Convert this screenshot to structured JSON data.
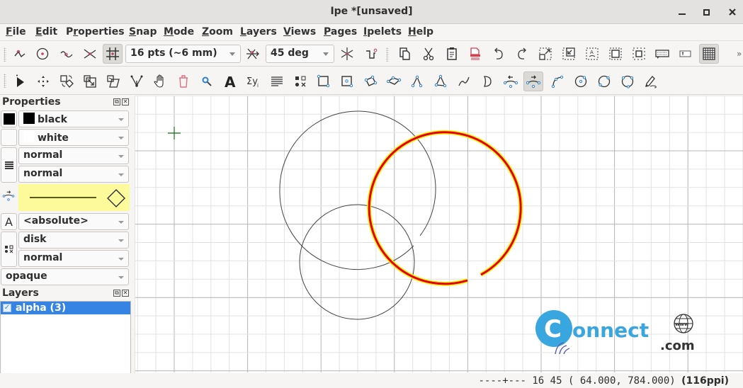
{
  "window": {
    "title": "Ipe *[unsaved]",
    "minimize_icon": "minimize-icon",
    "maximize_icon": "maximize-icon",
    "close_icon": "close-icon"
  },
  "menu": [
    {
      "label": "File",
      "mnemonic": "F",
      "rest": "ile"
    },
    {
      "label": "Edit",
      "mnemonic": "E",
      "rest": "dit"
    },
    {
      "label": "Properties",
      "pre": "P",
      "mnemonic": "r",
      "rest": "operties"
    },
    {
      "label": "Snap",
      "mnemonic": "S",
      "rest": "nap"
    },
    {
      "label": "Mode",
      "mnemonic": "M",
      "rest": "ode"
    },
    {
      "label": "Zoom",
      "mnemonic": "Z",
      "rest": "oom"
    },
    {
      "label": "Layers",
      "mnemonic": "L",
      "rest": "ayers"
    },
    {
      "label": "Views",
      "mnemonic": "V",
      "rest": "iews"
    },
    {
      "label": "Pages",
      "mnemonic": "P",
      "rest": "ages"
    },
    {
      "label": "Ipelets",
      "mnemonic": "I",
      "rest": "pelets"
    },
    {
      "label": "Help",
      "mnemonic": "H",
      "rest": "elp"
    }
  ],
  "snap_toolbar": {
    "buttons": [
      "snap-vertex-icon",
      "snap-center-icon",
      "snap-boundary-icon",
      "snap-intersection-icon",
      "snap-grid-icon"
    ],
    "grid_size": "16 pts (~6 mm)",
    "angle_snap_icon": "snap-angle-icon",
    "angle": "45 deg",
    "after_angle": [
      "snap-autoangle-icon",
      "snap-custom-icon"
    ]
  },
  "edit_toolbar": {
    "buttons": [
      "copy-icon",
      "cut-icon",
      "paste-icon",
      "delete-icon",
      "undo-icon",
      "redo-icon",
      "fit-page-icon",
      "fit-objects-icon",
      "fit-selection-icon",
      "zoom-in-icon",
      "zoom-out-icon",
      "keyboard-icon",
      "text-insert-icon",
      "grid-visible-icon"
    ],
    "overflow": "»"
  },
  "mode_toolbar": {
    "buttons": [
      "select-icon",
      "translate-icon",
      "rotate-icon",
      "stretch-icon",
      "shear-icon",
      "graph-icon",
      "pan-icon",
      "shred-icon",
      "magnify-icon",
      "label-icon",
      "math-icon",
      "paragraph-icon",
      "marks-icon",
      "rectangle-icon",
      "box-icon",
      "parallelogram-icon",
      "parallelogram2-icon",
      "line-icon",
      "polygon-icon",
      "spline-icon",
      "splinegon-icon",
      "arc-ccw-icon",
      "arc-cw-icon",
      "arc-3points-icon",
      "circle-center-icon",
      "circle-diameter-icon",
      "circle-3points-icon",
      "ink-icon"
    ],
    "active": "arc-cw-icon"
  },
  "properties": {
    "title": "Properties",
    "stroke_color": {
      "label": "black",
      "hex": "#000000"
    },
    "fill_color": {
      "label": "white",
      "hex": "#ffffff"
    },
    "pen_width": "normal",
    "dash_style": "normal",
    "text_size": "<absolute>",
    "mark_shape": "disk",
    "mark_size": "normal",
    "opacity": "opaque",
    "arrow_preview_bg": "#fdfa9c"
  },
  "layers": {
    "title": "Layers",
    "items": [
      {
        "label": "alpha (3)",
        "checked": true,
        "selected": true
      }
    ]
  },
  "canvas": {
    "grid_color_minor": "#e2e2e2",
    "grid_color_major": "#b4b4b4",
    "selection_color": "#e00000",
    "selection_halo": "#fff200",
    "cursor_color": "#1a6b1a"
  },
  "watermark": {
    "letter": "C",
    "word": "onnect",
    "domain": ".com",
    "globe_text": "www",
    "brand_color": "#3aa6e0"
  },
  "status": {
    "snap_indicator": "----+---",
    "grid_angle": "16 45",
    "coords": "( 64.000, 784.000)",
    "resolution": "(116ppi)"
  }
}
